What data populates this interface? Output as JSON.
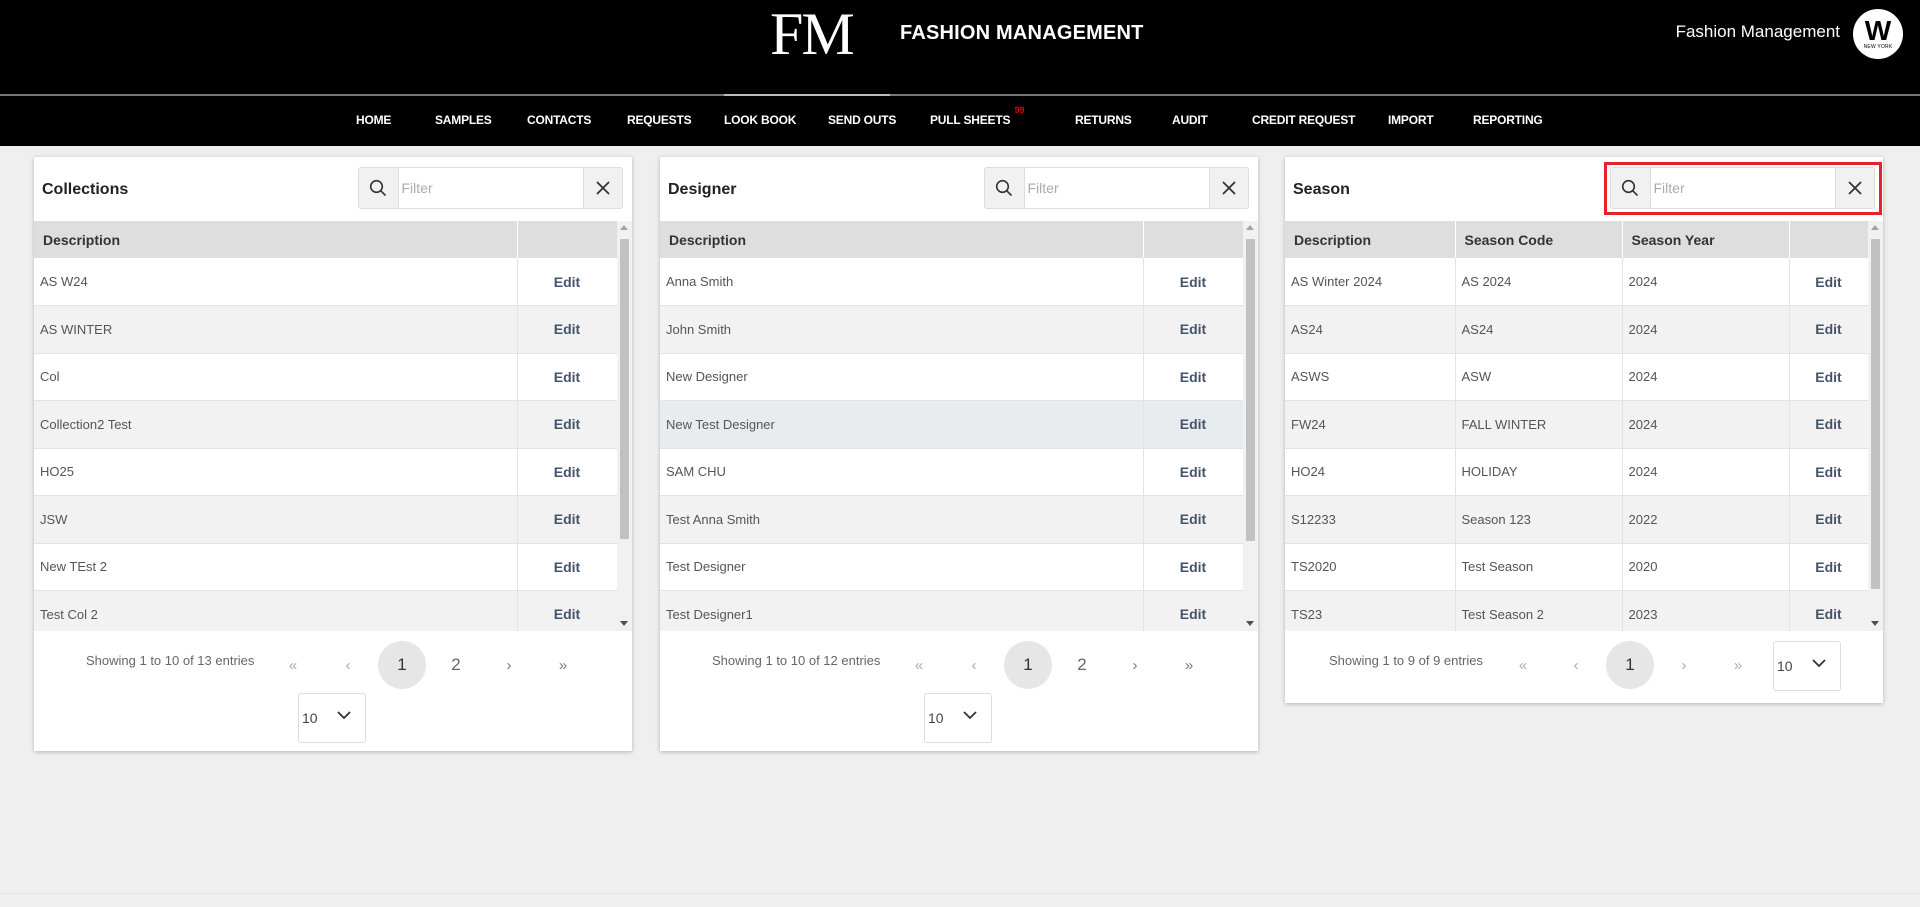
{
  "header": {
    "logo": "FM",
    "brand": "FASHION MANAGEMENT",
    "user_name": "Fashion Management",
    "avatar_letter": "W",
    "avatar_sub": "NEW YORK"
  },
  "nav": {
    "items": [
      "HOME",
      "SAMPLES",
      "CONTACTS",
      "REQUESTS",
      "LOOK BOOK",
      "SEND OUTS",
      "PULL SHEETS",
      "RETURNS",
      "AUDIT",
      "CREDIT REQUEST",
      "IMPORT",
      "REPORTING"
    ],
    "pull_sheets_badge": "99"
  },
  "panels": {
    "collections": {
      "title": "Collections",
      "filter_placeholder": "Filter",
      "columns": [
        "Description",
        ""
      ],
      "rows": [
        "AS W24",
        "AS WINTER",
        "Col",
        "Collection2 Test",
        "HO25",
        "JSW",
        "New TEst 2",
        "Test Col 2"
      ],
      "edit_label": "Edit",
      "info": "Showing 1 to 10 of 13 entries",
      "pages": [
        "1",
        "2"
      ],
      "page_size": "10"
    },
    "designer": {
      "title": "Designer",
      "filter_placeholder": "Filter",
      "columns": [
        "Description",
        ""
      ],
      "rows": [
        "Anna Smith",
        "John Smith",
        "New Designer",
        "New Test Designer",
        "SAM CHU",
        "Test Anna Smith",
        "Test Designer",
        "Test Designer1"
      ],
      "edit_label": "Edit",
      "info": "Showing 1 to 10 of 12 entries",
      "pages": [
        "1",
        "2"
      ],
      "page_size": "10"
    },
    "season": {
      "title": "Season",
      "filter_placeholder": "Filter",
      "columns": [
        "Description",
        "Season Code",
        "Season Year",
        ""
      ],
      "rows": [
        [
          "AS Winter 2024",
          "AS 2024",
          "2024"
        ],
        [
          "AS24",
          "AS24",
          "2024"
        ],
        [
          "ASWS",
          "ASW",
          "2024"
        ],
        [
          "FW24",
          "FALL WINTER",
          "2024"
        ],
        [
          "HO24",
          "HOLIDAY",
          "2024"
        ],
        [
          "S12233",
          "Season 123",
          "2022"
        ],
        [
          "TS2020",
          "Test Season",
          "2020"
        ],
        [
          "TS23",
          "Test Season 2",
          "2023"
        ]
      ],
      "edit_label": "Edit",
      "info": "Showing 1 to 9 of 9 entries",
      "pages": [
        "1"
      ],
      "page_size": "10"
    }
  },
  "pager_icons": {
    "first": "«",
    "prev": "‹",
    "next": "›",
    "last": "»"
  },
  "colors": {
    "header_bg": "#000000",
    "highlight": "#e8202a",
    "edit_text": "#44546a"
  }
}
